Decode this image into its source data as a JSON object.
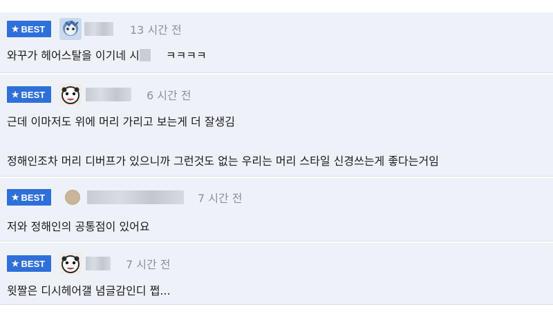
{
  "badge_label": "BEST",
  "comments": [
    {
      "time": "13 시간 전",
      "lines": [
        "와꾸가 헤어스탈을 이기네 시",
        "ㅋㅋㅋㅋ"
      ]
    },
    {
      "time": "6 시간 전",
      "lines": [
        "근데 이마저도 위에 머리 가리고 보는게 더 잘생김",
        "정해인조차 머리 디버프가 있으니까 그런것도 없는 우리는 머리 스타일 신경쓰는게 좋다는거임"
      ]
    },
    {
      "time": "7 시간 전",
      "lines": [
        "저와 정해인의 공통점이 있어요"
      ]
    },
    {
      "time": "7 시간 전",
      "lines": [
        "윗짤은 디시헤어갤 념글감인디 쩝..."
      ]
    }
  ],
  "colors": {
    "badge_bg": "#2f6fd9",
    "row_bg": "#eef2f8",
    "time_text": "#8a8f99"
  }
}
